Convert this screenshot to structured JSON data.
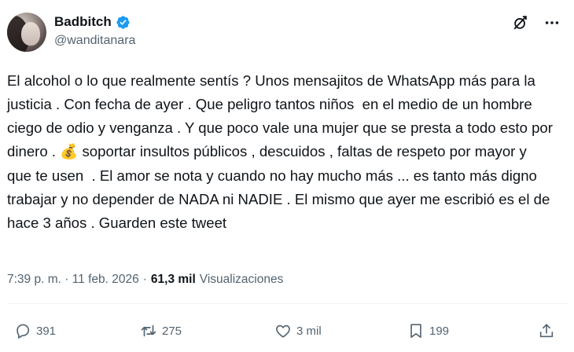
{
  "author": {
    "display_name": "Badbitch",
    "handle": "@wanditanara",
    "verified_icon": "verified-badge-icon",
    "avatar": "profile-photo"
  },
  "top_actions": {
    "grok_icon": "grok-icon",
    "more_icon": "more-options-icon"
  },
  "tweet": {
    "text_before_emoji": "El alcohol o lo que realmente sentís ? Unos mensajitos de WhatsApp más para la justicia . Con fecha de ayer . Que peligro tantos niños  en el medio de un hombre ciego de odio y venganza . Y que poco vale una mujer que se presta a todo esto por dinero . ",
    "emoji": "💰",
    "text_after_emoji": " soportar insultos públicos , descuidos , faltas de respeto por mayor y  que te usen  . El amor se nota y cuando no hay mucho más ... es tanto más digno trabajar y no depender de NADA ni NADIE . El mismo que ayer me escribió es el de hace 3 años . Guarden este tweet"
  },
  "meta": {
    "timestamp": "7:39 p. m. · 11 feb. 2026",
    "separator": "·",
    "views_count": "61,3 mil",
    "views_label": "Visualizaciones"
  },
  "actions": {
    "replies": "391",
    "reposts": "275",
    "likes": "3 mil",
    "bookmarks": "199"
  },
  "colors": {
    "text_primary": "#0f1419",
    "text_secondary": "#536471",
    "verified_blue": "#1d9bf0",
    "divider": "#eff3f4"
  }
}
